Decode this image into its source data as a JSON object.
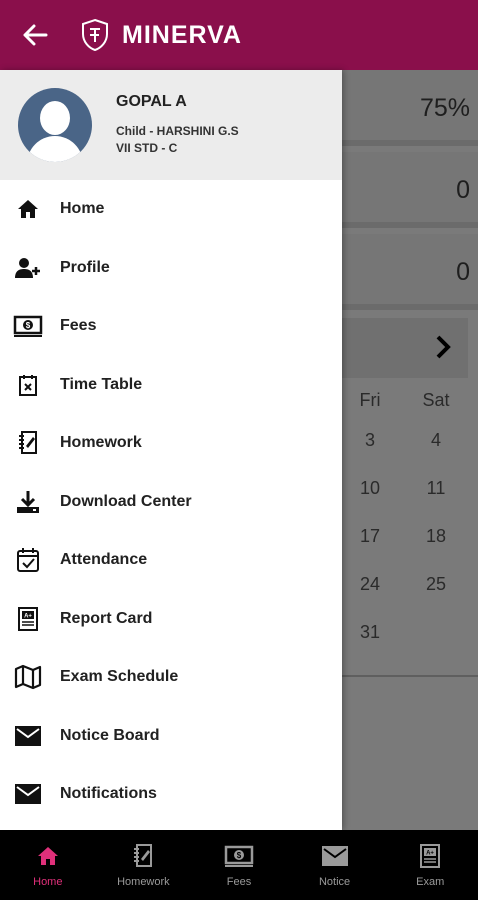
{
  "header": {
    "title": "MINERVA",
    "back_icon": "arrow-left-icon",
    "logo_icon": "school-crest-icon",
    "color": "#8a0f4b"
  },
  "background": {
    "stats": [
      "75%",
      "0",
      "0"
    ],
    "calendar": {
      "weekdays": [
        "Fri",
        "Sat"
      ],
      "days": [
        [
          "3",
          "4"
        ],
        [
          "10",
          "11"
        ],
        [
          "17",
          "18"
        ],
        [
          "24",
          "25"
        ],
        [
          "31",
          ""
        ]
      ]
    }
  },
  "drawer": {
    "profile": {
      "name": "GOPAL A",
      "child": "Child - HARSHINI G.S",
      "class": "VII STD - C"
    },
    "menu": [
      {
        "label": "Home",
        "icon": "home-icon"
      },
      {
        "label": "Profile",
        "icon": "add-user-icon"
      },
      {
        "label": "Fees",
        "icon": "money-icon"
      },
      {
        "label": "Time Table",
        "icon": "calendar-x-icon"
      },
      {
        "label": "Homework",
        "icon": "notebook-icon"
      },
      {
        "label": "Download Center",
        "icon": "download-icon"
      },
      {
        "label": "Attendance",
        "icon": "calendar-check-icon"
      },
      {
        "label": "Report Card",
        "icon": "report-card-icon"
      },
      {
        "label": "Exam Schedule",
        "icon": "map-icon"
      },
      {
        "label": "Notice Board",
        "icon": "mail-icon"
      },
      {
        "label": "Notifications",
        "icon": "mail-icon"
      }
    ]
  },
  "bottom_nav": {
    "active_color": "#e0307a",
    "items": [
      {
        "label": "Home",
        "icon": "home-icon",
        "active": true
      },
      {
        "label": "Homework",
        "icon": "notebook-icon",
        "active": false
      },
      {
        "label": "Fees",
        "icon": "money-icon",
        "active": false
      },
      {
        "label": "Notice",
        "icon": "mail-icon",
        "active": false
      },
      {
        "label": "Exam",
        "icon": "report-card-icon",
        "active": false
      }
    ]
  }
}
